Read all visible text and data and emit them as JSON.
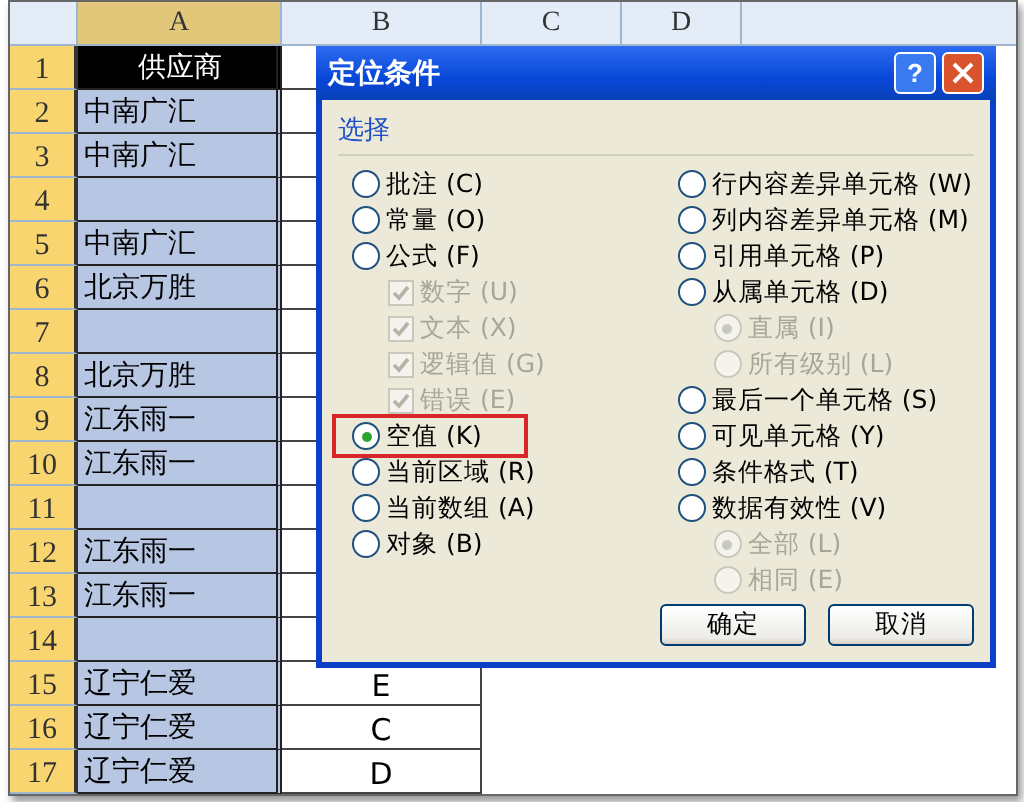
{
  "sheet": {
    "columns": [
      {
        "label": "A",
        "selected": true
      },
      {
        "label": "B",
        "selected": false
      },
      {
        "label": "C",
        "selected": false
      },
      {
        "label": "D",
        "selected": false
      }
    ],
    "rows": [
      {
        "number": "1",
        "selected": true,
        "kind": "header",
        "a": "供应商"
      },
      {
        "number": "2",
        "selected": true,
        "kind": "data",
        "a": "中南广汇"
      },
      {
        "number": "3",
        "selected": true,
        "kind": "data",
        "a": "中南广汇"
      },
      {
        "number": "4",
        "selected": true,
        "kind": "data"
      },
      {
        "number": "5",
        "selected": true,
        "kind": "data",
        "a": "中南广汇"
      },
      {
        "number": "6",
        "selected": true,
        "kind": "data",
        "a": "北京万胜"
      },
      {
        "number": "7",
        "selected": true,
        "kind": "data"
      },
      {
        "number": "8",
        "selected": true,
        "kind": "data",
        "a": "北京万胜"
      },
      {
        "number": "9",
        "selected": true,
        "kind": "data",
        "a": "江东雨一"
      },
      {
        "number": "10",
        "selected": true,
        "kind": "data",
        "a": "江东雨一"
      },
      {
        "number": "11",
        "selected": true,
        "kind": "data"
      },
      {
        "number": "12",
        "selected": true,
        "kind": "data",
        "a": "江东雨一"
      },
      {
        "number": "13",
        "selected": true,
        "kind": "data",
        "a": "江东雨一"
      },
      {
        "number": "14",
        "selected": true,
        "kind": "data"
      },
      {
        "number": "15",
        "selected": true,
        "kind": "data",
        "a": "辽宁仁爱",
        "b": "E"
      },
      {
        "number": "16",
        "selected": true,
        "kind": "data",
        "a": "辽宁仁爱",
        "b": "C"
      },
      {
        "number": "17",
        "selected": true,
        "kind": "data",
        "a": "辽宁仁爱",
        "b": "D"
      }
    ]
  },
  "dialog": {
    "title": "定位条件",
    "help_button": "?",
    "group_label": "选择",
    "left_options": [
      {
        "label": "批注 (C)",
        "selected": false,
        "highlighted": false
      },
      {
        "label": "常量 (O)",
        "selected": false,
        "highlighted": false
      },
      {
        "label": "公式 (F)",
        "selected": false,
        "highlighted": false,
        "children": [
          {
            "kind": "checkbox",
            "label": "数字 (U)",
            "checked": true,
            "disabled": true
          },
          {
            "kind": "checkbox",
            "label": "文本 (X)",
            "checked": true,
            "disabled": true
          },
          {
            "kind": "checkbox",
            "label": "逻辑值 (G)",
            "checked": true,
            "disabled": true
          },
          {
            "kind": "checkbox",
            "label": "错误 (E)",
            "checked": true,
            "disabled": true
          }
        ]
      },
      {
        "label": "空值 (K)",
        "selected": true,
        "highlighted": true
      },
      {
        "label": "当前区域 (R)",
        "selected": false,
        "highlighted": false
      },
      {
        "label": "当前数组 (A)",
        "selected": false,
        "highlighted": false
      },
      {
        "label": "对象 (B)",
        "selected": false,
        "highlighted": false
      }
    ],
    "right_options": [
      {
        "label": "行内容差异单元格 (W)",
        "selected": false,
        "highlighted": false
      },
      {
        "label": "列内容差异单元格 (M)",
        "selected": false,
        "highlighted": false
      },
      {
        "label": "引用单元格 (P)",
        "selected": false,
        "highlighted": false
      },
      {
        "label": "从属单元格 (D)",
        "selected": false,
        "highlighted": false,
        "children": [
          {
            "kind": "radio",
            "label": "直属 (I)",
            "checked": true,
            "disabled": true
          },
          {
            "kind": "radio",
            "label": "所有级别 (L)",
            "checked": false,
            "disabled": true
          }
        ]
      },
      {
        "label": "最后一个单元格 (S)",
        "selected": false,
        "highlighted": false
      },
      {
        "label": "可见单元格 (Y)",
        "selected": false,
        "highlighted": false
      },
      {
        "label": "条件格式 (T)",
        "selected": false,
        "highlighted": false
      },
      {
        "label": "数据有效性 (V)",
        "selected": false,
        "highlighted": false,
        "children": [
          {
            "kind": "radio",
            "label": "全部 (L)",
            "checked": true,
            "disabled": true
          },
          {
            "kind": "radio",
            "label": "相同 (E)",
            "checked": false,
            "disabled": true
          }
        ]
      }
    ],
    "buttons": [
      "确定",
      "取消"
    ]
  }
}
